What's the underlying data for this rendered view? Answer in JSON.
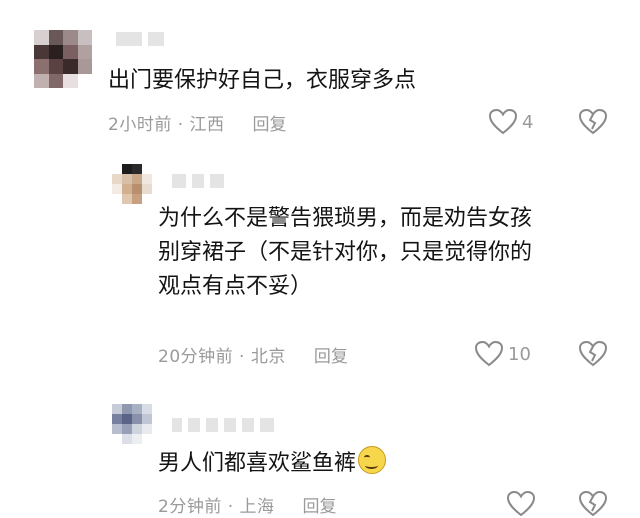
{
  "comments": [
    {
      "text": "出门要保护好自己，衣服穿多点",
      "time_location": "2小时前 · 江西",
      "reply_label": "回复",
      "like_count": "4"
    },
    {
      "text": "为什么不是警告猥琐男，而是劝告女孩\n别穿裙子（不是针对你，只是觉得你的\n观点有点不妥）",
      "time_location": "20分钟前 · 北京",
      "reply_label": "回复",
      "like_count": "10"
    },
    {
      "text": "男人们都喜欢鲨鱼裤",
      "emoji": "smirk-emoji",
      "time_location": "2分钟前 · 上海",
      "reply_label": "回复",
      "like_count": ""
    }
  ],
  "colors": {
    "text": "#141414",
    "meta": "#9a9a9a",
    "background": "#ffffff"
  }
}
